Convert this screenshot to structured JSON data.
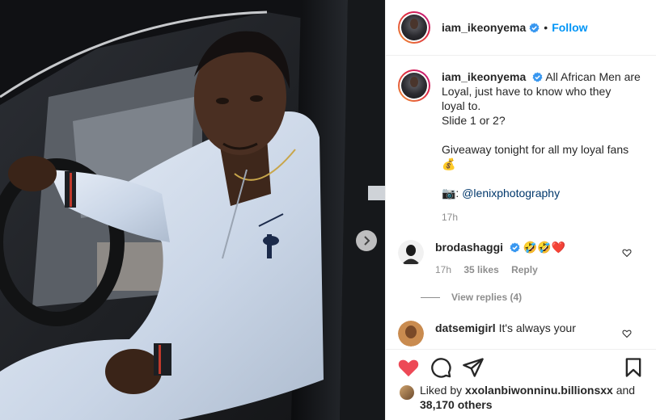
{
  "post": {
    "username": "iam_ikeonyema",
    "follow_label": "Follow",
    "separator": "•",
    "caption_lines": [
      "All African Men are",
      "Loyal, just have to know who they",
      "loyal to.",
      "Slide 1 or 2?"
    ],
    "caption_giveaway": "Giveaway tonight for all my loyal fans",
    "caption_money_emoji": "💰",
    "caption_camera_emoji": "📷:",
    "caption_mention": "@lenixphotography",
    "caption_time": "17h"
  },
  "comments": [
    {
      "username": "brodashaggi",
      "text": "🤣🤣❤️",
      "time": "17h",
      "likes": "35 likes",
      "reply_label": "Reply",
      "view_replies": "View replies (4)"
    },
    {
      "username": "datsemigirl",
      "text": "It's always your"
    }
  ],
  "likes": {
    "prefix": "Liked by",
    "user": "xxolanbiwonninu.billionsxx",
    "and": "and",
    "others": "38,170 others"
  },
  "icons": {
    "like": "heart-icon",
    "comment": "comment-icon",
    "share": "paper-plane-icon",
    "save": "bookmark-icon",
    "next": "chevron-right-icon",
    "verified": "verified-badge-icon"
  },
  "colors": {
    "follow": "#0095f6",
    "like_active": "#ed4956",
    "verified": "#3897f0",
    "muted": "#8e8e8e"
  }
}
